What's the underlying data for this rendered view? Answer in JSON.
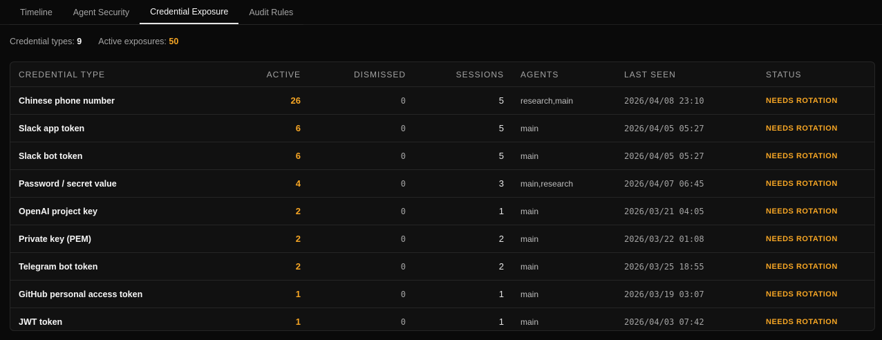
{
  "tabs": [
    {
      "label": "Timeline",
      "active": false
    },
    {
      "label": "Agent Security",
      "active": false
    },
    {
      "label": "Credential Exposure",
      "active": true
    },
    {
      "label": "Audit Rules",
      "active": false
    }
  ],
  "summary": {
    "types_label": "Credential types:",
    "types_value": "9",
    "exposures_label": "Active exposures:",
    "exposures_value": "50"
  },
  "table": {
    "headers": {
      "type": "CREDENTIAL TYPE",
      "active": "ACTIVE",
      "dismissed": "DISMISSED",
      "sessions": "SESSIONS",
      "agents": "AGENTS",
      "last_seen": "LAST SEEN",
      "status": "STATUS"
    },
    "rows": [
      {
        "type": "Chinese phone number",
        "active": "26",
        "dismissed": "0",
        "sessions": "5",
        "agents": "research,main",
        "last_seen": "2026/04/08 23:10",
        "status": "NEEDS ROTATION"
      },
      {
        "type": "Slack app token",
        "active": "6",
        "dismissed": "0",
        "sessions": "5",
        "agents": "main",
        "last_seen": "2026/04/05 05:27",
        "status": "NEEDS ROTATION"
      },
      {
        "type": "Slack bot token",
        "active": "6",
        "dismissed": "0",
        "sessions": "5",
        "agents": "main",
        "last_seen": "2026/04/05 05:27",
        "status": "NEEDS ROTATION"
      },
      {
        "type": "Password / secret value",
        "active": "4",
        "dismissed": "0",
        "sessions": "3",
        "agents": "main,research",
        "last_seen": "2026/04/07 06:45",
        "status": "NEEDS ROTATION"
      },
      {
        "type": "OpenAI project key",
        "active": "2",
        "dismissed": "0",
        "sessions": "1",
        "agents": "main",
        "last_seen": "2026/03/21 04:05",
        "status": "NEEDS ROTATION"
      },
      {
        "type": "Private key (PEM)",
        "active": "2",
        "dismissed": "0",
        "sessions": "2",
        "agents": "main",
        "last_seen": "2026/03/22 01:08",
        "status": "NEEDS ROTATION"
      },
      {
        "type": "Telegram bot token",
        "active": "2",
        "dismissed": "0",
        "sessions": "2",
        "agents": "main",
        "last_seen": "2026/03/25 18:55",
        "status": "NEEDS ROTATION"
      },
      {
        "type": "GitHub personal access token",
        "active": "1",
        "dismissed": "0",
        "sessions": "1",
        "agents": "main",
        "last_seen": "2026/03/19 03:07",
        "status": "NEEDS ROTATION"
      },
      {
        "type": "JWT token",
        "active": "1",
        "dismissed": "0",
        "sessions": "1",
        "agents": "main",
        "last_seen": "2026/04/03 07:42",
        "status": "NEEDS ROTATION"
      }
    ]
  },
  "colors": {
    "accent_amber": "#f5a524",
    "background": "#0a0a0a",
    "panel": "#111111",
    "border": "#262626"
  }
}
